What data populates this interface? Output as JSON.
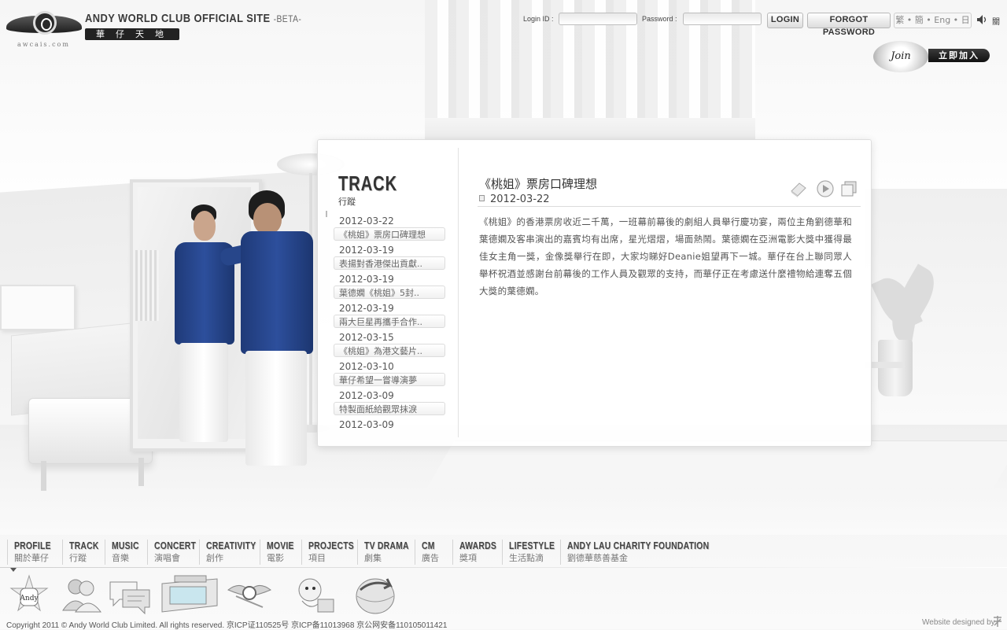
{
  "header": {
    "site_title": "ANDY WORLD CLUB OFFICIAL SITE",
    "site_beta": "-BETA-",
    "site_subtitle": "華仔天地",
    "logo_url": "awcais.com",
    "login_id_label": "Login ID :",
    "password_label": "Password :",
    "login_button": "LOGIN",
    "forgot_button": "FORGOT PASSWORD",
    "language_selector": "繁 • 簡 • Eng • 日",
    "sound_label": "關",
    "join_badge": "Join",
    "join_label": "立即加入"
  },
  "panel": {
    "section_title": "TRACK",
    "section_subtitle": "行蹤",
    "news": [
      {
        "date": "2012-03-22",
        "title": "《桃姐》票房口碑理想"
      },
      {
        "date": "2012-03-19",
        "title": "表揚對香港傑出貢獻.."
      },
      {
        "date": "2012-03-19",
        "title": "葉德嫻《桃姐》5封.."
      },
      {
        "date": "2012-03-19",
        "title": "兩大巨星再攜手合作.."
      },
      {
        "date": "2012-03-15",
        "title": "《桃姐》為港文藝片.."
      },
      {
        "date": "2012-03-10",
        "title": "華仔希望一嘗導演夢"
      },
      {
        "date": "2012-03-09",
        "title": "特製面紙給觀眾抹淚"
      },
      {
        "date": "2012-03-09",
        "title": ""
      }
    ],
    "article": {
      "title": "《桃姐》票房口碑理想",
      "date": "2012-03-22",
      "body": "《桃姐》的香港票房收近二千萬，一班幕前幕後的劇組人員舉行慶功宴，兩位主角劉德華和葉德嫻及客串演出的嘉賓均有出席，星光熠熠，場面熱鬧。葉德嫻在亞洲電影大獎中獲得最佳女主角一獎，金像獎舉行在即，大家均睇好Deanie姐望再下一城。華仔在台上聯同眾人舉杯祝酒並感謝台前幕後的工作人員及觀眾的支持，而華仔正在考慮送什麼禮物給連奪五個大獎的葉德嫻。"
    }
  },
  "nav": [
    {
      "en": "PROFILE",
      "zh": "關於華仔"
    },
    {
      "en": "TRACK",
      "zh": "行蹤"
    },
    {
      "en": "MUSIC",
      "zh": "音樂"
    },
    {
      "en": "CONCERT",
      "zh": "演唱會"
    },
    {
      "en": "CREATIVITY",
      "zh": "創作"
    },
    {
      "en": "MOVIE",
      "zh": "電影"
    },
    {
      "en": "PROJECTS",
      "zh": "項目"
    },
    {
      "en": "TV DRAMA",
      "zh": "劇集"
    },
    {
      "en": "CM",
      "zh": "廣告"
    },
    {
      "en": "AWARDS",
      "zh": "獎項"
    },
    {
      "en": "LIFESTYLE",
      "zh": "生活點滴"
    },
    {
      "en": "ANDY LAU CHARITY FOUNDATION",
      "zh": "劉德華慈善基金"
    }
  ],
  "quick_links": [
    "andy-lau-badge-icon",
    "members-icon",
    "chat-bubbles-icon",
    "shop-window-icon",
    "winged-ring-icon",
    "cartoon-mascot-icon",
    "globe-arrow-icon"
  ],
  "footer": {
    "copyright": "Copyright 2011 © Andy World Club Limited. All rights reserved.  京ICP证110525号  京ICP备11013968  京公网安备110105011421",
    "credit": "Website designed by"
  },
  "colors": {
    "accent": "#222222",
    "shirt": "#24438a",
    "panel_border": "#dedede"
  }
}
